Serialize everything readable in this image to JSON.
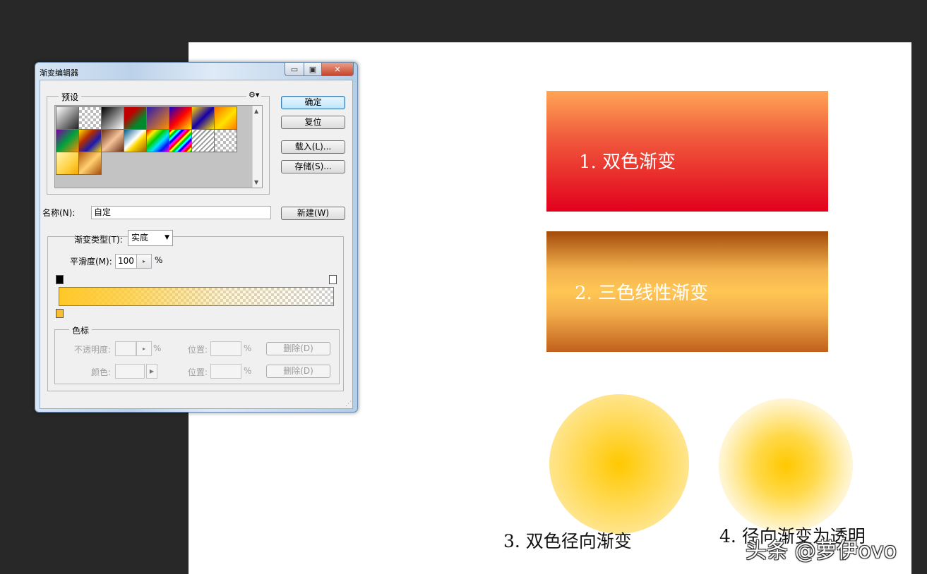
{
  "canvas": {
    "panel1_label": "1. 双色渐变",
    "panel2_label": "2. 三色线性渐变",
    "caption3": "3. 双色径向渐变",
    "caption4": "4. 径向渐变为透明",
    "watermark": "头条 @萝伊ovo"
  },
  "dialog": {
    "title": "渐变编辑器",
    "window_buttons": {
      "minimize": "▭",
      "maximize": "▣",
      "close": "✕"
    },
    "presets": {
      "label": "预设",
      "gear_icon": "⚙▾",
      "scroll_up": "▲",
      "scroll_down": "▼"
    },
    "buttons": {
      "ok": "确定",
      "reset": "复位",
      "load": "载入(L)...",
      "save": "存储(S)...",
      "new": "新建(W)"
    },
    "name": {
      "label": "名称(N):",
      "value": "自定"
    },
    "gradient_type": {
      "label": "渐变类型(T):",
      "value": "实底",
      "arrow": "▼"
    },
    "smoothness": {
      "label": "平滑度(M):",
      "value": "100",
      "unit": "%",
      "stepper": "▸"
    },
    "color_stops": {
      "label": "色标",
      "opacity_label": "不透明度:",
      "opacity_unit": "%",
      "opacity_stepper": "▸",
      "position_label_1": "位置:",
      "position_unit_1": "%",
      "delete_1": "删除(D)",
      "color_label": "颜色:",
      "color_arrow": "▶",
      "position_label_2": "位置:",
      "position_unit_2": "%",
      "delete_2": "删除(D)"
    },
    "grip": "⋰"
  }
}
